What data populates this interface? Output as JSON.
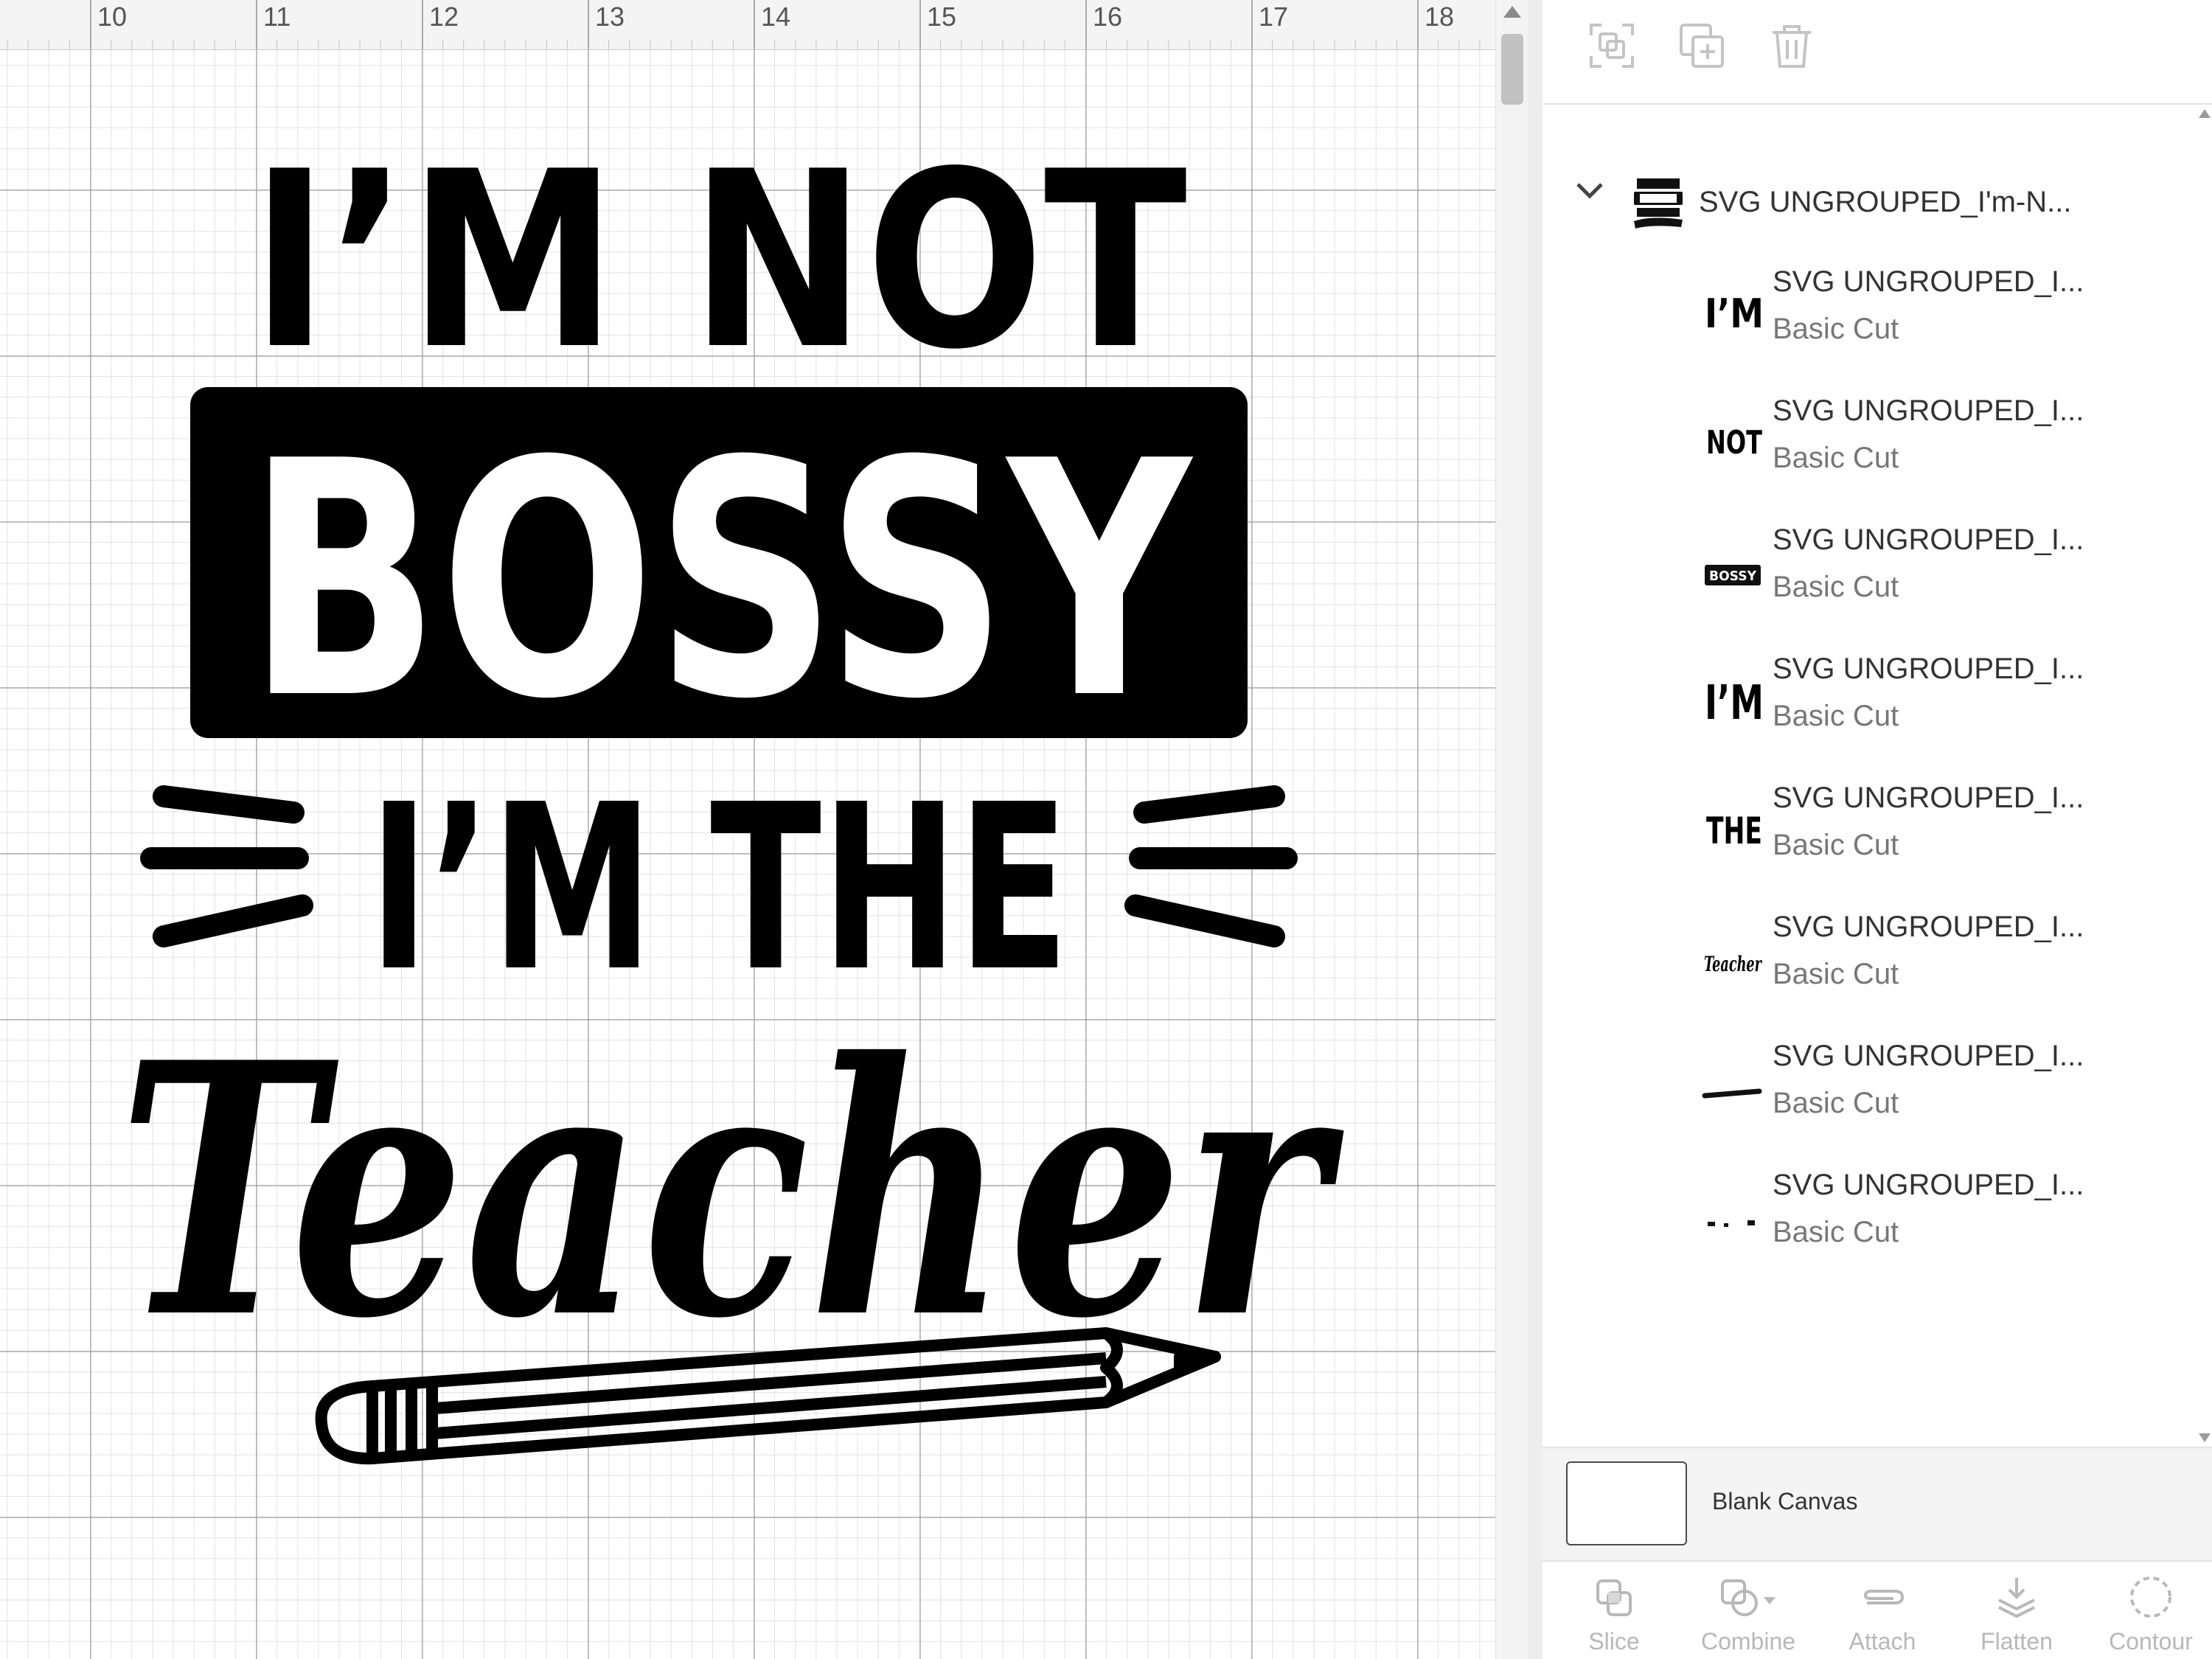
{
  "ruler": {
    "numbers": [
      "10",
      "11",
      "12",
      "13",
      "14",
      "15",
      "16",
      "17",
      "18"
    ]
  },
  "artwork": {
    "line1": "I’M NOT",
    "line2": "BOSSY",
    "line3": "I’M THE",
    "line4": "Teacher",
    "color": "#000000"
  },
  "toolbar": {
    "icons": [
      "group-selection-icon",
      "duplicate-icon",
      "delete-icon"
    ]
  },
  "layers": {
    "group": {
      "name": "SVG UNGROUPED_I'm-N...",
      "expanded": true
    },
    "items": [
      {
        "thumb": "I’M",
        "name": "SVG UNGROUPED_I...",
        "type": "Basic Cut"
      },
      {
        "thumb": "NOT",
        "name": "SVG UNGROUPED_I...",
        "type": "Basic Cut"
      },
      {
        "thumb": "BOSSY",
        "name": "SVG UNGROUPED_I...",
        "type": "Basic Cut"
      },
      {
        "thumb": "I’M",
        "name": "SVG UNGROUPED_I...",
        "type": "Basic Cut"
      },
      {
        "thumb": "THE",
        "name": "SVG UNGROUPED_I...",
        "type": "Basic Cut"
      },
      {
        "thumb": "Teacher",
        "name": "SVG UNGROUPED_I...",
        "type": "Basic Cut"
      },
      {
        "thumb": "dash",
        "name": "SVG UNGROUPED_I...",
        "type": "Basic Cut"
      },
      {
        "thumb": "dots",
        "name": "SVG UNGROUPED_I...",
        "type": "Basic Cut"
      }
    ]
  },
  "blank_canvas": {
    "label": "Blank Canvas"
  },
  "actions": [
    {
      "label": "Slice",
      "icon": "slice-icon"
    },
    {
      "label": "Combine",
      "icon": "combine-icon"
    },
    {
      "label": "Attach",
      "icon": "attach-icon"
    },
    {
      "label": "Flatten",
      "icon": "flatten-icon"
    },
    {
      "label": "Contour",
      "icon": "contour-icon"
    }
  ],
  "colors": {
    "panel_bg": "#ffffff",
    "disabled": "#b8b8b8",
    "grid_major": "#969696",
    "grid_minor": "#bebebe"
  }
}
